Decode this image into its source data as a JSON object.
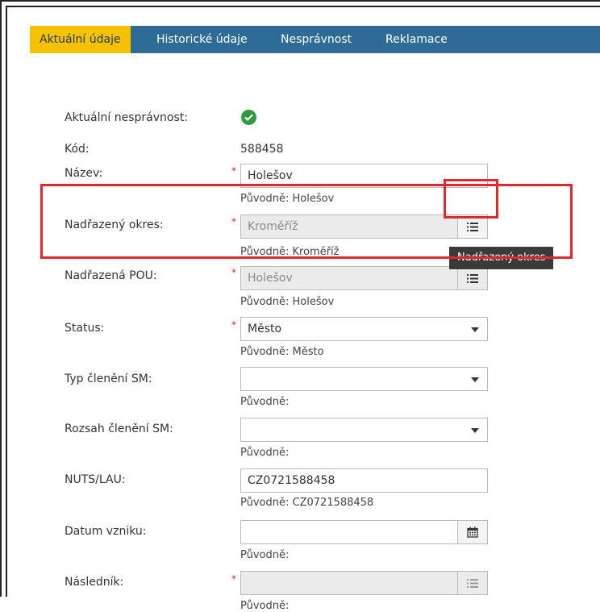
{
  "tabs": [
    {
      "label": "Aktuální údaje",
      "active": true
    },
    {
      "label": "Historické údaje",
      "active": false
    },
    {
      "label": "Nesprávnost",
      "active": false
    },
    {
      "label": "Reklamace",
      "active": false
    }
  ],
  "fields": {
    "aktualni_nespravnost": {
      "label": "Aktuální nesprávnost:",
      "status_icon": "check-circle-icon",
      "status_color": "#2e9a3a"
    },
    "kod": {
      "label": "Kód:",
      "value": "588458"
    },
    "nazev": {
      "label": "Název:",
      "value": "Holešov",
      "original": "Původně: Holešov",
      "required": "*"
    },
    "nadrazeny_okres": {
      "label": "Nadřazený okres:",
      "value": "Kroměříž",
      "original": "Původně: Kroměříž",
      "required": "*",
      "button_icon": "list-icon"
    },
    "nadrazena_pou": {
      "label": "Nadřazená POU:",
      "value": "Holešov",
      "original": "Původně: Holešov",
      "required": "*",
      "button_icon": "list-icon"
    },
    "status": {
      "label": "Status:",
      "value": "Město",
      "original": "Původně: Město",
      "required": "*"
    },
    "typ_cleneni_sm": {
      "label": "Typ členění SM:",
      "value": "",
      "original": "Původně:"
    },
    "rozsah_cleneni_sm": {
      "label": "Rozsah členění SM:",
      "value": "",
      "original": "Původně:"
    },
    "nuts_lau": {
      "label": "NUTS/LAU:",
      "value": "CZ0721588458",
      "original": "Původně: CZ0721588458"
    },
    "datum_vzniku": {
      "label": "Datum vzniku:",
      "value": "",
      "original": "Původně:",
      "button_icon": "calendar-icon"
    },
    "naslednik": {
      "label": "Následník:",
      "value": "",
      "original": "Původně:",
      "required": "*",
      "button_icon": "list-icon"
    }
  },
  "tooltip": {
    "text": "Nadřazený okres"
  },
  "colors": {
    "tab_bar": "#2e6c95",
    "tab_active": "#f6c200",
    "required_marker": "#d12b2b",
    "highlight": "#e0282e"
  }
}
